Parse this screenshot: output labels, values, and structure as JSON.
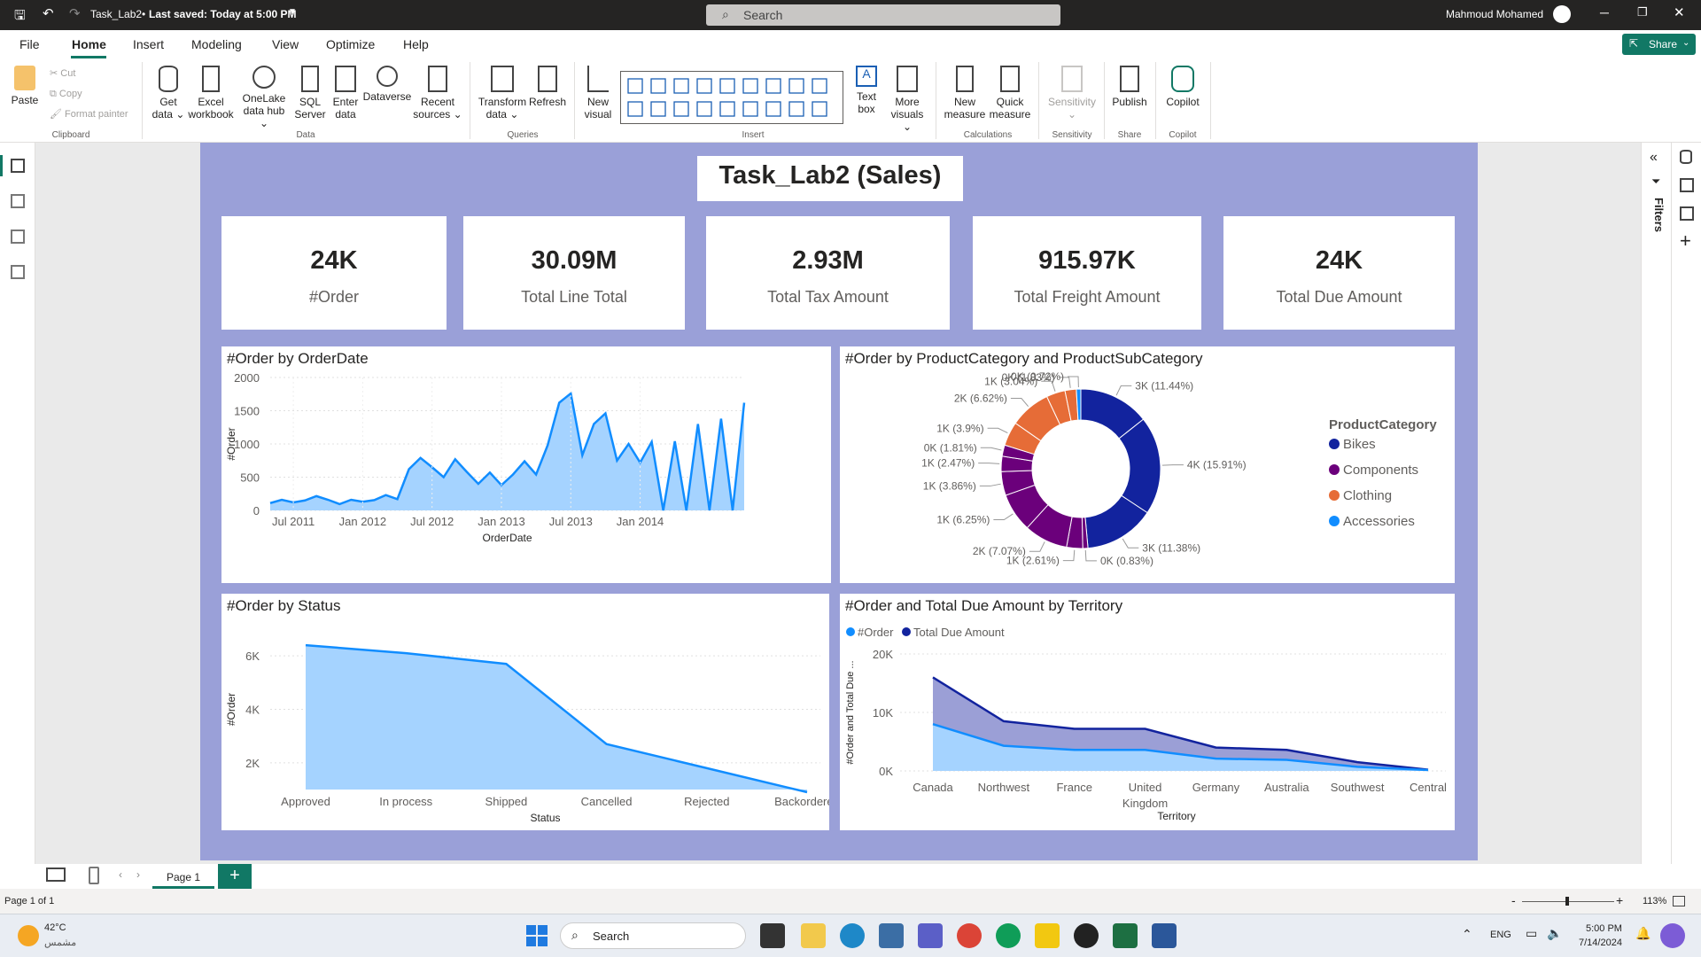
{
  "titlebar": {
    "doc": "Task_Lab2",
    "saved": "Last saved: Today at 5:00 PM",
    "search_placeholder": "Search",
    "user": "Mahmoud Mohamed"
  },
  "menu": [
    "File",
    "Home",
    "Insert",
    "Modeling",
    "View",
    "Optimize",
    "Help"
  ],
  "share_label": "Share",
  "ribbon": {
    "clipboard": {
      "paste": "Paste",
      "cut": "Cut",
      "copy": "Copy",
      "format_painter": "Format painter",
      "group": "Clipboard"
    },
    "data": {
      "get": "Get",
      "get2": "data",
      "excel": "Excel",
      "excel2": "workbook",
      "onelake": "OneLake",
      "onelake2": "data hub",
      "sql": "SQL",
      "sql2": "Server",
      "enter": "Enter",
      "enter2": "data",
      "dataverse": "Dataverse",
      "recent": "Recent",
      "recent2": "sources",
      "group": "Data"
    },
    "queries": {
      "transform": "Transform",
      "transform2": "data",
      "refresh": "Refresh",
      "group": "Queries"
    },
    "insert": {
      "newvisual": "New",
      "newvisual2": "visual",
      "textbox": "Text",
      "textbox2": "box",
      "more": "More",
      "more2": "visuals",
      "group": "Insert"
    },
    "calc": {
      "newmeasure": "New",
      "newmeasure2": "measure",
      "quick": "Quick",
      "quick2": "measure",
      "group": "Calculations"
    },
    "sensitivity": {
      "label": "Sensitivity",
      "group": "Sensitivity"
    },
    "share": {
      "publish": "Publish",
      "group": "Share"
    },
    "copilot": {
      "label": "Copilot",
      "group": "Copilot"
    }
  },
  "report": {
    "title": "Task_Lab2 (Sales)",
    "kpis": [
      {
        "value": "24K",
        "label": "#Order"
      },
      {
        "value": "30.09M",
        "label": "Total Line Total"
      },
      {
        "value": "2.93M",
        "label": "Total Tax Amount"
      },
      {
        "value": "915.97K",
        "label": "Total Freight Amount"
      },
      {
        "value": "24K",
        "label": "Total Due Amount"
      }
    ]
  },
  "filters_label": "Filters",
  "page_tab": "Page 1",
  "status": {
    "page": "Page 1 of 1",
    "zoom": "113%"
  },
  "taskbar": {
    "temp": "42°C",
    "weather": "مشمس",
    "search": "Search",
    "lang": "ENG",
    "time": "5:00 PM",
    "date": "7/14/2024"
  },
  "colors": {
    "report_bg": "#9aa0d8",
    "accent": "#117865",
    "line": "#118DFF",
    "area": "#a5d3ff",
    "navy": "#12239E",
    "purple": "#6B007B",
    "orange": "#E66C37"
  },
  "chart_data": [
    {
      "type": "area",
      "title": "#Order by OrderDate",
      "xlabel": "OrderDate",
      "ylabel": "#Order",
      "ylim": [
        0,
        2000
      ],
      "y_ticks": [
        "0",
        "500",
        "1000",
        "1500",
        "2000"
      ],
      "x_ticks": [
        "Jul 2011",
        "Jan 2012",
        "Jul 2012",
        "Jan 2013",
        "Jul 2013",
        "Jan 2014"
      ],
      "x": [
        "2011-05",
        "2011-06",
        "2011-07",
        "2011-08",
        "2011-09",
        "2011-10",
        "2011-11",
        "2011-12",
        "2012-01",
        "2012-02",
        "2012-03",
        "2012-04",
        "2012-05",
        "2012-06",
        "2012-07",
        "2012-08",
        "2012-09",
        "2012-10",
        "2012-11",
        "2012-12",
        "2013-01",
        "2013-02",
        "2013-03",
        "2013-04",
        "2013-05",
        "2013-06",
        "2013-07",
        "2013-08",
        "2013-09",
        "2013-10",
        "2013-11",
        "2013-12",
        "2014-01",
        "2014-01b",
        "2014-02",
        "2014-02b",
        "2014-03",
        "2014-03b",
        "2014-04",
        "2014-04b",
        "2014-05",
        "2014-05b"
      ],
      "values": [
        110,
        160,
        120,
        150,
        215,
        160,
        95,
        160,
        130,
        155,
        230,
        170,
        620,
        790,
        650,
        500,
        770,
        580,
        400,
        570,
        380,
        540,
        740,
        540,
        980,
        1620,
        1760,
        830,
        1300,
        1460,
        750,
        1000,
        720,
        1030,
        0,
        1040,
        0,
        1300,
        0,
        1380,
        0,
        1620
      ]
    },
    {
      "type": "pie",
      "title": "#Order by ProductCategory and ProductSubCategory",
      "legend_title": "ProductCategory",
      "legend": [
        {
          "name": "Bikes",
          "color": "#12239E"
        },
        {
          "name": "Components",
          "color": "#6B007B"
        },
        {
          "name": "Clothing",
          "color": "#E66C37"
        },
        {
          "name": "Accessories",
          "color": "#118DFF"
        }
      ],
      "slices": [
        {
          "label": "3K (11.44%)",
          "pct": 11.44,
          "cat": "Bikes"
        },
        {
          "label": "4K (15.91%)",
          "pct": 15.91,
          "cat": "Bikes"
        },
        {
          "label": "3K (11.38%)",
          "pct": 11.38,
          "cat": "Bikes"
        },
        {
          "label": "0K (0.83%)",
          "pct": 0.83,
          "cat": "Components"
        },
        {
          "label": "1K (2.61%)",
          "pct": 2.61,
          "cat": "Components"
        },
        {
          "label": "2K (7.07%)",
          "pct": 7.07,
          "cat": "Components"
        },
        {
          "label": "1K (6.25%)",
          "pct": 6.25,
          "cat": "Components"
        },
        {
          "label": "1K (3.86%)",
          "pct": 3.86,
          "cat": "Components"
        },
        {
          "label": "1K (2.47%)",
          "pct": 2.47,
          "cat": "Components"
        },
        {
          "label": "0K (1.81%)",
          "pct": 1.81,
          "cat": "Components"
        },
        {
          "label": "1K (3.9%)",
          "pct": 3.9,
          "cat": "Clothing"
        },
        {
          "label": "2K (6.62%)",
          "pct": 6.62,
          "cat": "Clothing"
        },
        {
          "label": "1K (3.04%)",
          "pct": 3.04,
          "cat": "Clothing"
        },
        {
          "label": "0K (1.83%)",
          "pct": 1.83,
          "cat": "Clothing"
        },
        {
          "label": "0K (0.72%)",
          "pct": 0.72,
          "cat": "Accessories"
        }
      ]
    },
    {
      "type": "area",
      "title": "#Order by Status",
      "xlabel": "Status",
      "ylabel": "#Order",
      "y_ticks": [
        "2K",
        "4K",
        "6K"
      ],
      "categories": [
        "Approved",
        "In process",
        "Shipped",
        "Cancelled",
        "Rejected",
        "Backordered"
      ],
      "values": [
        6400,
        6100,
        5700,
        2700,
        1800,
        900
      ]
    },
    {
      "type": "area",
      "title": "#Order and Total Due Amount by Territory",
      "xlabel": "Territory",
      "ylabel": "#Order and Total Due ...",
      "y_ticks": [
        "0K",
        "10K",
        "20K"
      ],
      "categories": [
        "Canada",
        "Northwest",
        "France",
        "United Kingdom",
        "Germany",
        "Australia",
        "Southwest",
        "Central"
      ],
      "series": [
        {
          "name": "#Order",
          "values": [
            8000,
            4300,
            3600,
            3600,
            2100,
            1900,
            700,
            150
          ],
          "color": "#118DFF"
        },
        {
          "name": "Total Due Amount",
          "values": [
            16000,
            8500,
            7200,
            7200,
            4000,
            3600,
            1500,
            200
          ],
          "color": "#12239E"
        }
      ]
    }
  ]
}
